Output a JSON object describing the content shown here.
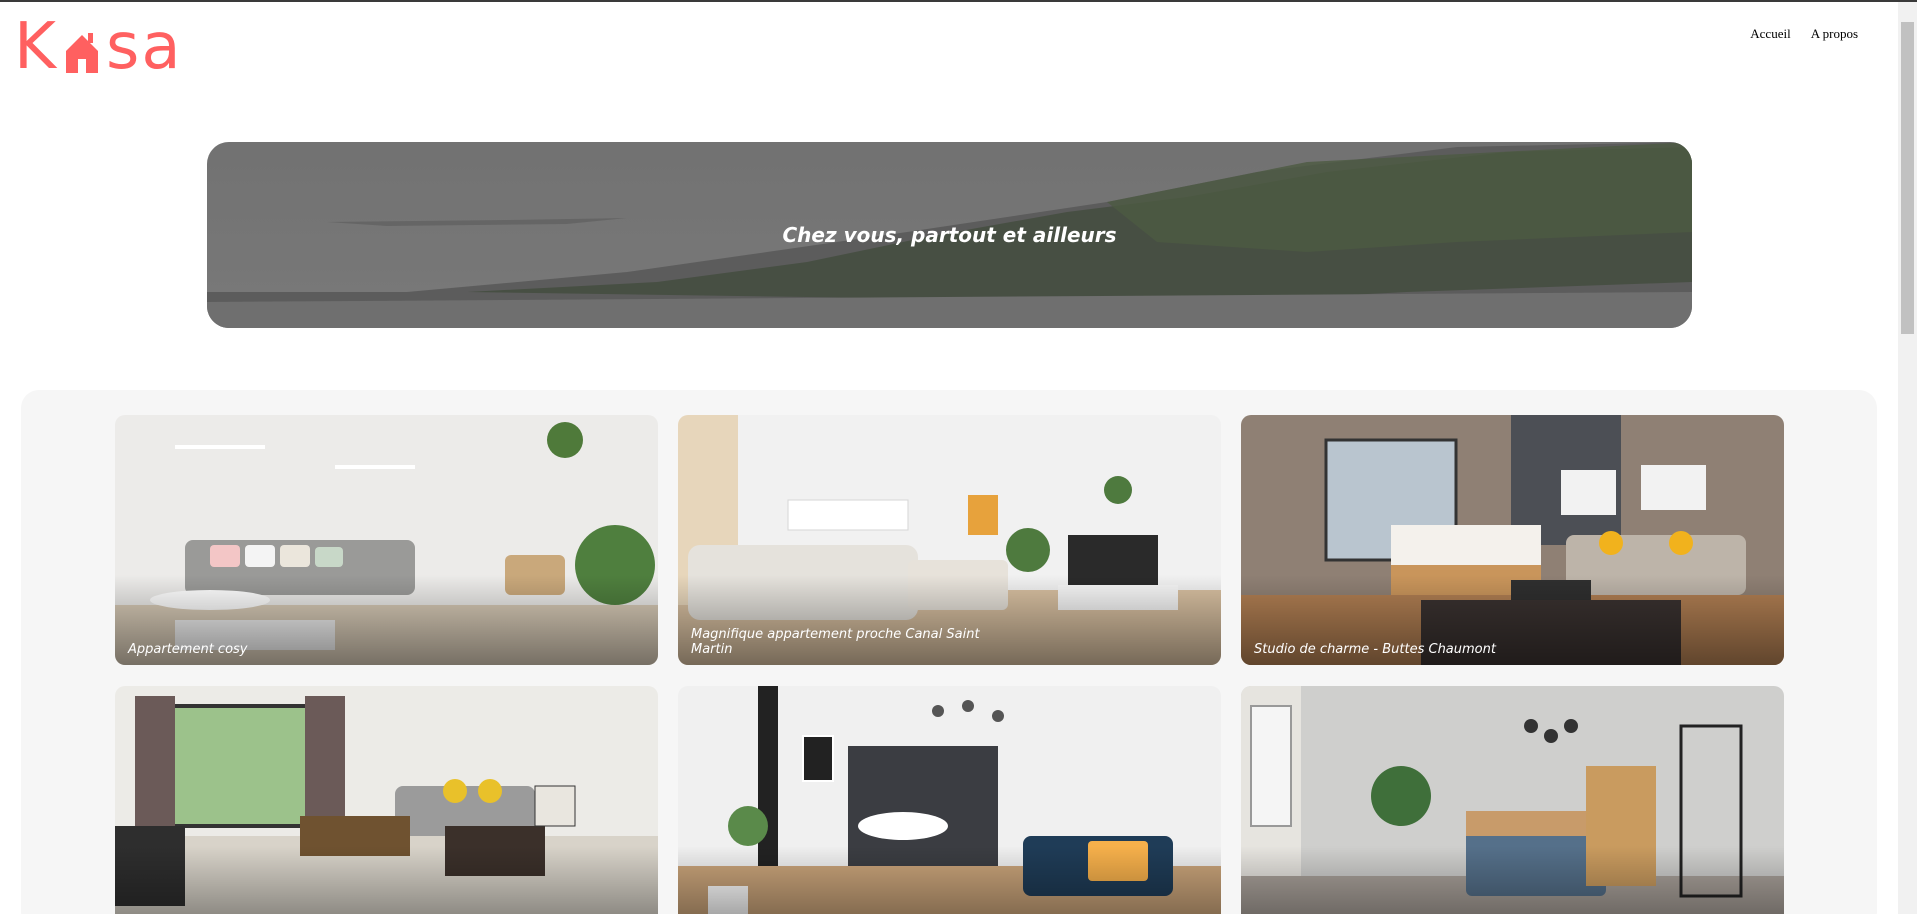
{
  "header": {
    "logo_text_left": "K",
    "logo_text_right": "sa",
    "nav": [
      {
        "label": "Accueil"
      },
      {
        "label": "A propos"
      }
    ]
  },
  "banner": {
    "title": "Chez vous, partout et ailleurs"
  },
  "gallery": {
    "cards": [
      {
        "title": "Appartement cosy"
      },
      {
        "title": "Magnifique appartement proche Canal Saint Martin"
      },
      {
        "title": "Studio de charme - Buttes Chaumont"
      },
      {
        "title": ""
      },
      {
        "title": ""
      },
      {
        "title": ""
      }
    ]
  },
  "colors": {
    "brand": "#FF6060",
    "gallery_bg": "#F6F6F6"
  }
}
